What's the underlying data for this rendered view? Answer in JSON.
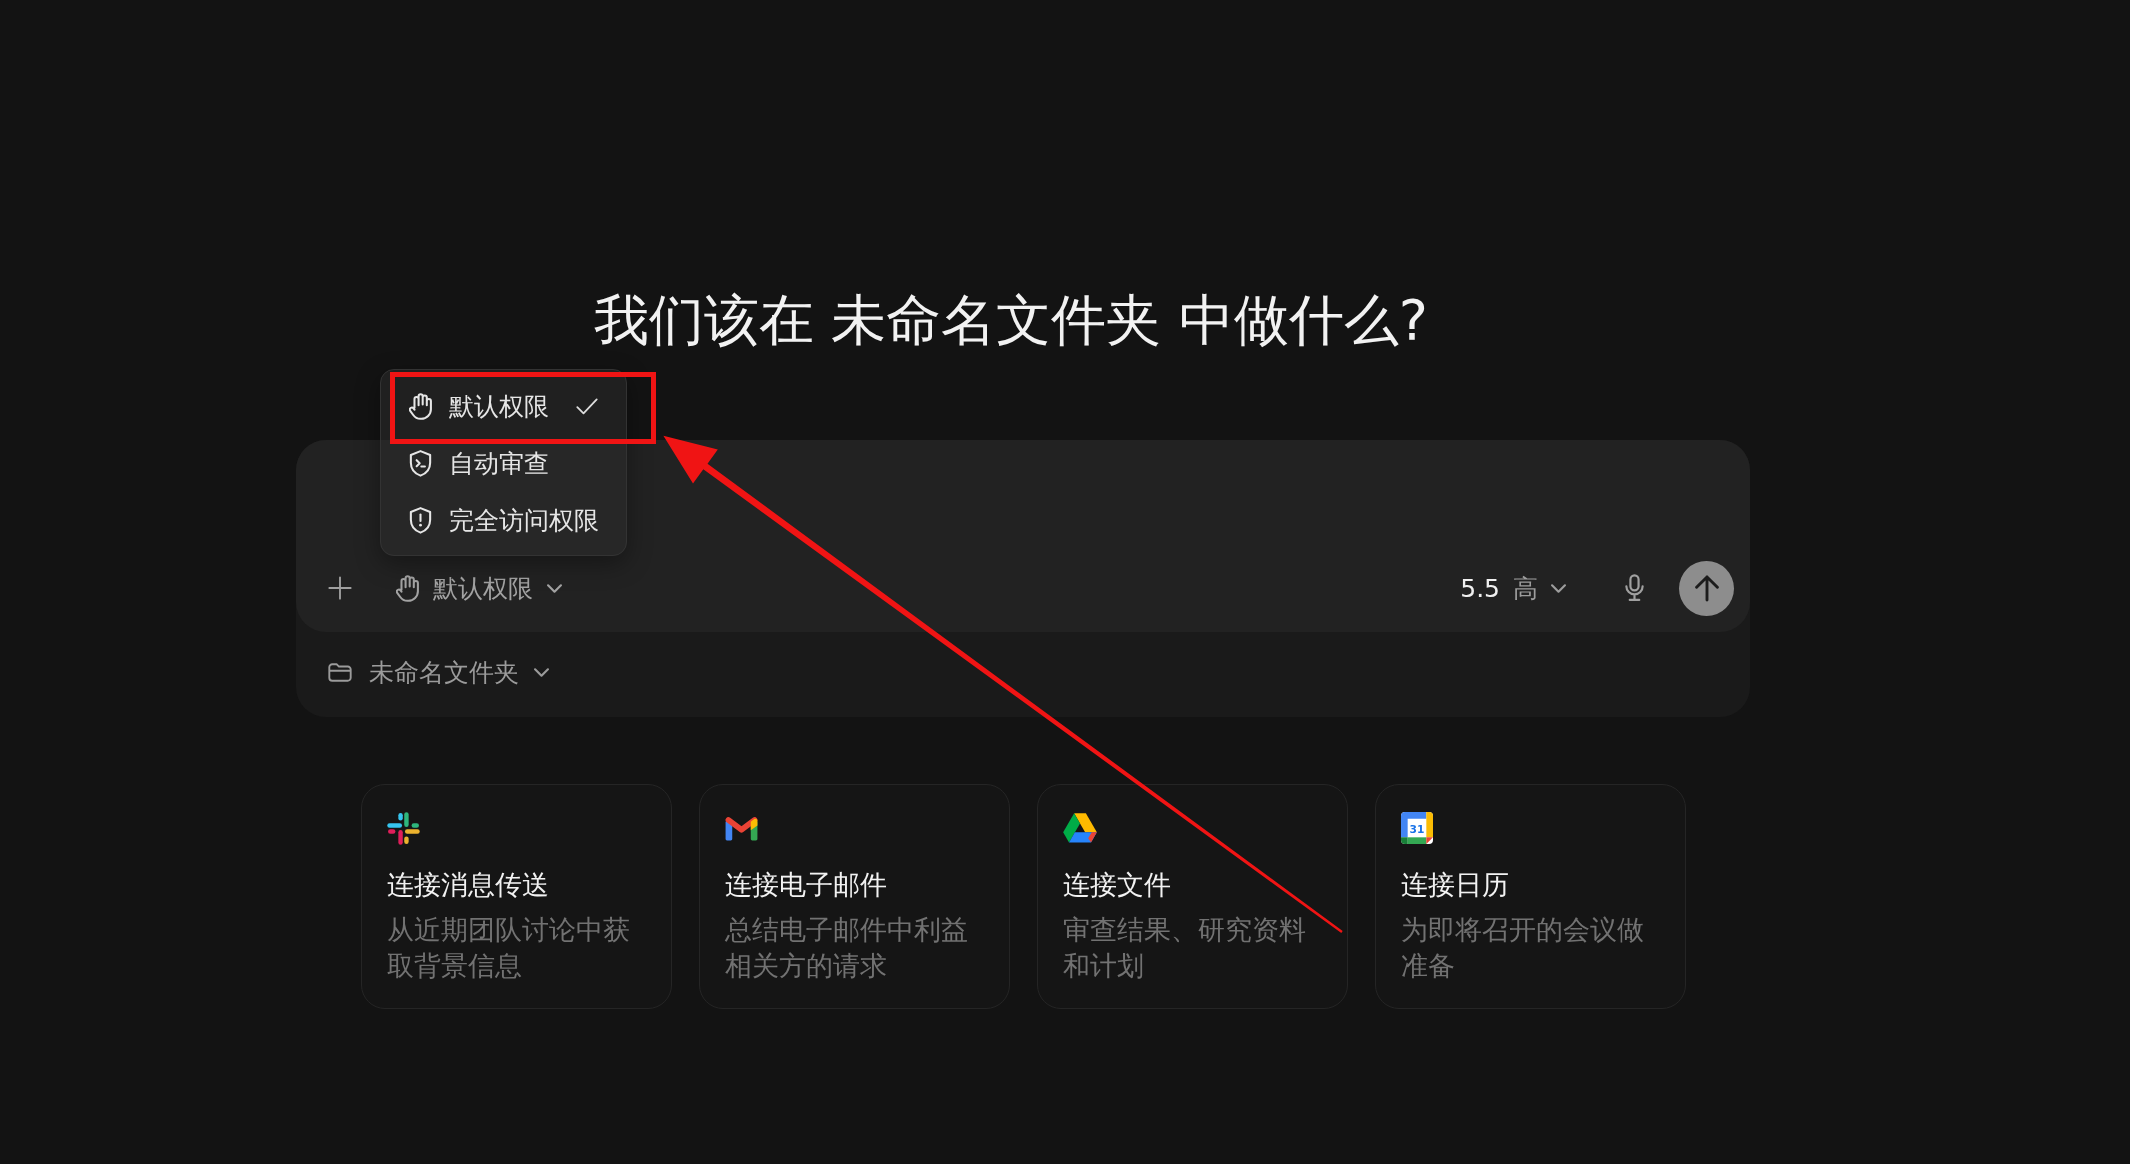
{
  "heading": "我们该在 未命名文件夹 中做什么?",
  "composer": {
    "permission_button": {
      "label": "默认权限"
    },
    "model_selector": {
      "version": "5.5",
      "effort": "高"
    }
  },
  "permission_menu": {
    "open": true,
    "items": [
      {
        "label": "默认权限",
        "selected": true
      },
      {
        "label": "自动审查",
        "selected": false
      },
      {
        "label": "完全访问权限",
        "selected": false
      }
    ]
  },
  "folder_selector": {
    "label": "未命名文件夹"
  },
  "connector_cards": [
    {
      "title": "连接消息传送",
      "description": "从近期团队讨论中获取背景信息"
    },
    {
      "title": "连接电子邮件",
      "description": "总结电子邮件中利益相关方的请求"
    },
    {
      "title": "连接文件",
      "description": "审查结果、研究资料和计划"
    },
    {
      "title": "连接日历",
      "description": "为即将召开的会议做准备",
      "icon_label": "31"
    }
  ],
  "annotation": {
    "highlight_box": true,
    "arrow": true
  }
}
